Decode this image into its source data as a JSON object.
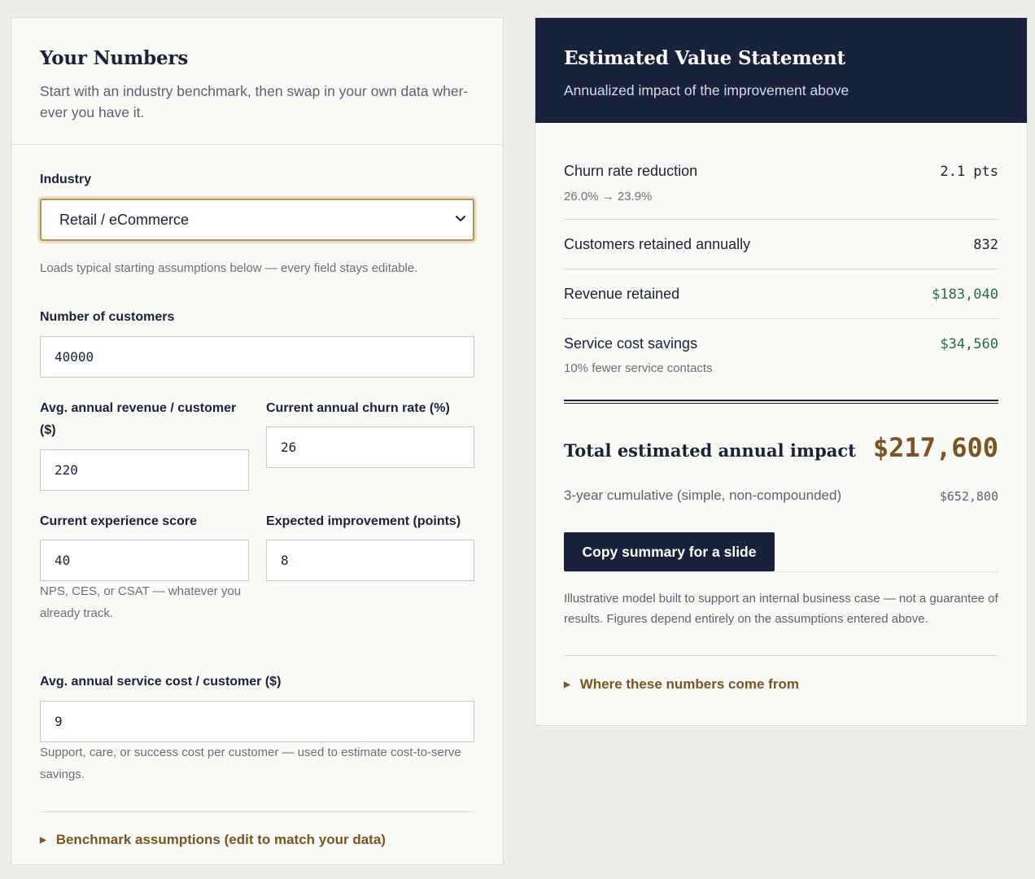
{
  "inputs": {
    "title": "Your Numbers",
    "subtitle": "Start with an industry benchmark, then swap in your own data wher­ever you have it.",
    "industry": {
      "label": "Industry",
      "value": "Retail / eCommerce",
      "help": "Loads typical starting assumptions below — every field stays editable."
    },
    "customers": {
      "label": "Number of customers",
      "value": "40000"
    },
    "revenue": {
      "label": "Avg. annual revenue / customer ($)",
      "value": "220"
    },
    "churn": {
      "label": "Current annual churn rate (%)",
      "value": "26"
    },
    "experience": {
      "label": "Current experience score",
      "value": "40",
      "help": "NPS, CES, or CSAT — whatever you already track."
    },
    "improvement": {
      "label": "Expected improvement (points)",
      "value": "8"
    },
    "service_cost": {
      "label": "Avg. annual service cost / customer ($)",
      "value": "9",
      "help": "Support, care, or success cost per customer — used to estimate cost-to-serve savings."
    },
    "assumptions_toggle": "Benchmark assumptions (edit to match your data)"
  },
  "statement": {
    "title": "Estimated Value Statement",
    "subtitle": "Annualized impact of the improvement above",
    "rows": [
      {
        "label": "Churn rate reduction",
        "value": "2.1 pts",
        "sub": "26.0% → 23.9%"
      },
      {
        "label": "Customers retained annually",
        "value": "832"
      },
      {
        "label": "Revenue retained",
        "value": "$183,040"
      },
      {
        "label": "Service cost savings",
        "value": "$34,560",
        "sub": "10% fewer service contacts"
      }
    ],
    "total_label": "Total estimated annual impact",
    "total_value": "$217,600",
    "cumulative_label": "3-year cumulative (simple, non-compounded)",
    "cumulative_value": "$652,800",
    "copy_button": "Copy summary for a slide",
    "disclaimer": "Illustrative model built to support an internal business case — not a guarantee of results. Figures depend entirely on the assumptions entered above.",
    "sources_toggle": "Where these numbers come from"
  },
  "colors": {
    "navy": "#18223b",
    "accent_brown": "#7a5422",
    "positive_green": "#2f6a45",
    "background": "#eeeeea"
  },
  "icons": {
    "select_arrow": "chevron-down-icon",
    "disclosure": "triangle-right-icon"
  }
}
